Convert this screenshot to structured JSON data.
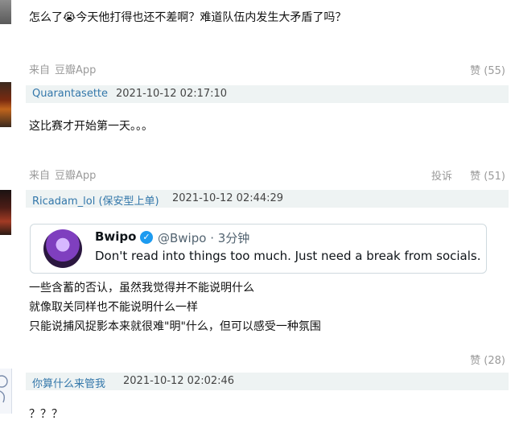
{
  "comments": [
    {
      "text": "怎么了😭今天他打得也还不差啊？难道队伍内发生大矛盾了吗？",
      "source_prefix": "来自",
      "source_app": "豆瓣App",
      "like": "赞 (55)"
    },
    {
      "username": "Quarantasette",
      "time": "2021-10-12 02:17:10",
      "text": "这比赛才开始第一天。。。",
      "source_prefix": "来自",
      "source_app": "豆瓣App",
      "report": "投诉",
      "like": "赞 (51)"
    },
    {
      "username": "Ricadam_lol (保安型上单)",
      "time": "2021-10-12 02:44:29",
      "tweet": {
        "name": "Bwipo",
        "verified_icon": "✓",
        "handle": "@Bwipo · 3分钟",
        "text": "Don't read into things too much. Just need a break from socials."
      },
      "lines": [
        "一些含蓄的否认，虽然我觉得并不能说明什么",
        "就像取关同样也不能说明什么一样",
        "只能说捕风捉影本来就很难\"明\"什么，但可以感受一种氛围"
      ],
      "like": "赞 (28)"
    },
    {
      "username": "你算什么来管我",
      "time": "2021-10-12 02:02:46",
      "text": "？？？"
    }
  ]
}
